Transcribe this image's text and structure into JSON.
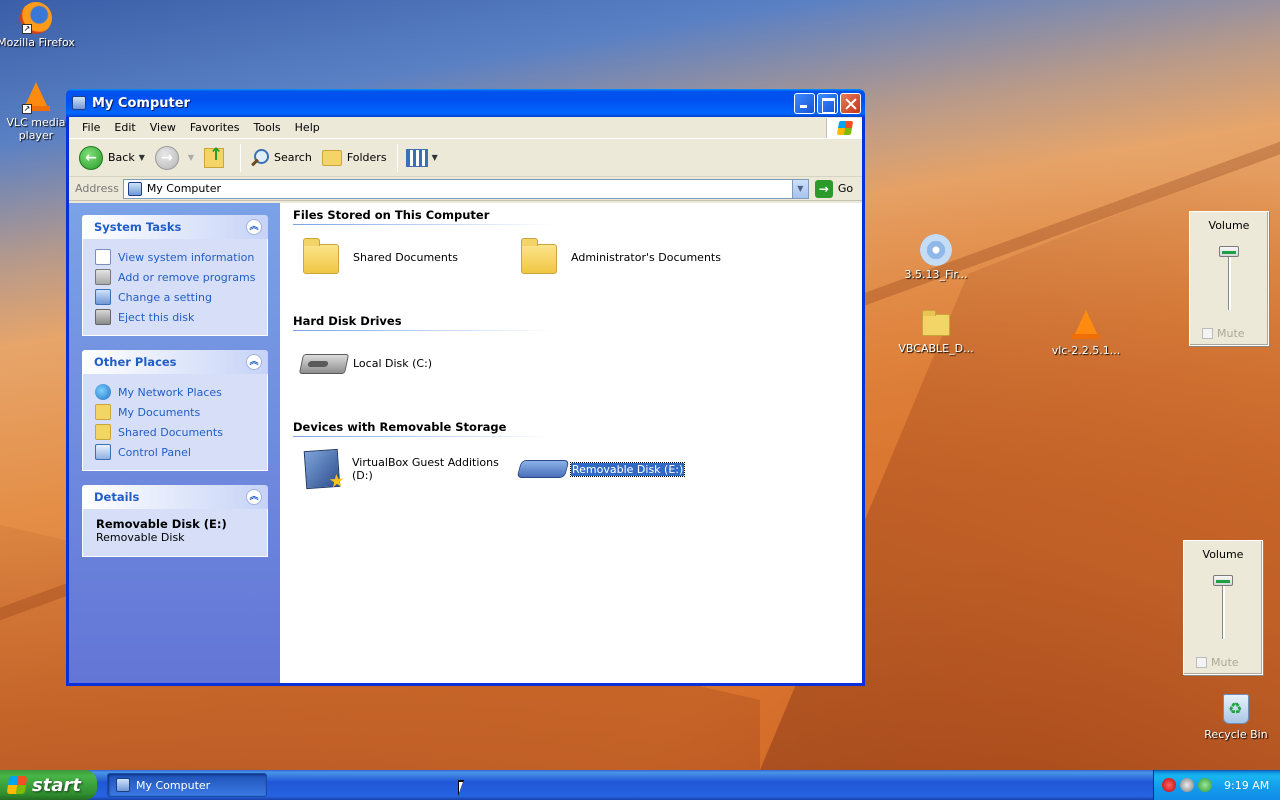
{
  "desktop": {
    "icons": [
      {
        "label": "Mozilla Firefox",
        "icon": "firefox-icon"
      },
      {
        "label": "VLC media player",
        "icon": "vlc-icon"
      },
      {
        "label": "3.5.13_Fir...",
        "icon": "cd-installer-icon"
      },
      {
        "label": "VBCABLE_D...",
        "icon": "folder-icon"
      },
      {
        "label": "vlc-2.2.5.1...",
        "icon": "vlc-icon"
      },
      {
        "label": "Recycle Bin",
        "icon": "recycle-bin-icon"
      }
    ]
  },
  "volume_popups": [
    {
      "title": "Volume",
      "mute_label": "Mute",
      "muted": false
    },
    {
      "title": "Volume",
      "mute_label": "Mute",
      "muted": false
    }
  ],
  "window": {
    "title": "My Computer",
    "menu": [
      "File",
      "Edit",
      "View",
      "Favorites",
      "Tools",
      "Help"
    ],
    "toolbar": {
      "back": "Back",
      "search": "Search",
      "folders": "Folders"
    },
    "address": {
      "label": "Address",
      "value": "My Computer",
      "go": "Go"
    },
    "taskpane": {
      "system_tasks": {
        "title": "System Tasks",
        "items": [
          "View system information",
          "Add or remove programs",
          "Change a setting",
          "Eject this disk"
        ]
      },
      "other_places": {
        "title": "Other Places",
        "items": [
          "My Network Places",
          "My Documents",
          "Shared Documents",
          "Control Panel"
        ]
      },
      "details": {
        "title": "Details",
        "name": "Removable Disk (E:)",
        "type": "Removable Disk"
      }
    },
    "groups": [
      {
        "title": "Files Stored on This Computer",
        "items": [
          "Shared Documents",
          "Administrator's Documents"
        ]
      },
      {
        "title": "Hard Disk Drives",
        "items": [
          "Local Disk (C:)"
        ]
      },
      {
        "title": "Devices with Removable Storage",
        "items": [
          "VirtualBox Guest Additions (D:)",
          "Removable Disk (E:)"
        ]
      }
    ],
    "selected_item": "Removable Disk (E:)"
  },
  "taskbar": {
    "start": "start",
    "task_button": "My Computer",
    "clock": "9:19 AM"
  },
  "colors": {
    "titlebar": "#0053ee",
    "taskpane": "#7ba2e7",
    "selection": "#316ac5",
    "start_button": "#3c9a3c"
  }
}
